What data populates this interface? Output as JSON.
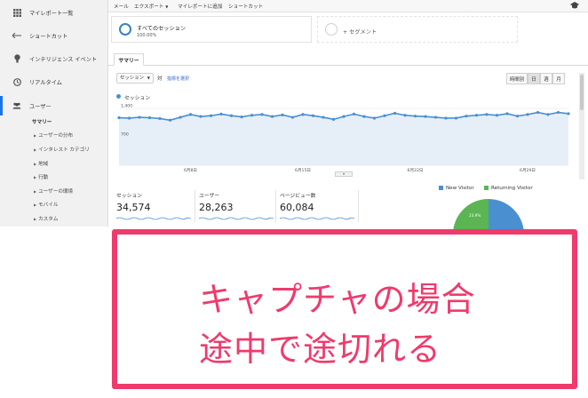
{
  "sidebar": {
    "items": [
      {
        "label": "マイレポート一覧",
        "icon": "grid-icon"
      },
      {
        "label": "ショートカット",
        "icon": "shortcut-arrow-icon"
      },
      {
        "label": "インテリジェンス イベント",
        "icon": "bulb-icon"
      },
      {
        "label": "リアルタイム",
        "icon": "clock-icon"
      },
      {
        "label": "ユーザー",
        "icon": "users-icon"
      }
    ],
    "subitems": [
      "サマリー",
      "ユーザーの分布",
      "インタレスト カテゴリ",
      "地域",
      "行動",
      "ユーザーの環境",
      "モバイル",
      "カスタム"
    ]
  },
  "topbar": {
    "mail": "メール",
    "export": "エクスポート",
    "add_report": "マイレポートに追加",
    "shortcut": "ショートカット"
  },
  "segments": {
    "all_sessions": "すべてのセッション",
    "all_sessions_pct": "100.00%",
    "add_segment": "+ セグメント"
  },
  "tab": {
    "summary": "サマリー"
  },
  "controls": {
    "metric": "セッション",
    "vs": "対",
    "pick_metric": "指標を選択",
    "periods": [
      "時間別",
      "日",
      "週",
      "月"
    ],
    "active_period_index": 1
  },
  "chart_data": {
    "type": "line",
    "series": [
      {
        "name": "セッション",
        "values": [
          1170,
          1160,
          1180,
          1170,
          1150,
          1110,
          1180,
          1250,
          1200,
          1220,
          1260,
          1220,
          1190,
          1230,
          1250,
          1200,
          1240,
          1180,
          1250,
          1220,
          1180,
          1130,
          1200,
          1260,
          1200,
          1160,
          1220,
          1280,
          1230,
          1210,
          1200,
          1180,
          1160,
          1160,
          1210,
          1230,
          1250,
          1230,
          1270,
          1210,
          1250,
          1300,
          1250,
          1300,
          1270
        ]
      }
    ],
    "y_ticks": [
      "1,400",
      "700"
    ],
    "ylim": [
      0,
      1400
    ],
    "x_ticks": [
      "6月8日",
      "6月15日",
      "6月22日",
      "6月29日"
    ],
    "color": "#4a8fd0",
    "fill": "#e6eff8",
    "grid": true
  },
  "metrics": [
    {
      "label": "セッション",
      "value": "34,574"
    },
    {
      "label": "ユーザー",
      "value": "28,263"
    },
    {
      "label": "ページビュー数",
      "value": "60,084"
    }
  ],
  "pie": {
    "legend": [
      {
        "label": "New Visitor",
        "color": "#4a8fd0"
      },
      {
        "label": "Returning Visitor",
        "color": "#5ab552"
      }
    ],
    "returning_label": "23.9%",
    "returning_fraction": 0.239
  },
  "callout": {
    "line1": "キャプチャの場合",
    "line2": "途中で途切れる",
    "color": "#ee3b6c"
  }
}
